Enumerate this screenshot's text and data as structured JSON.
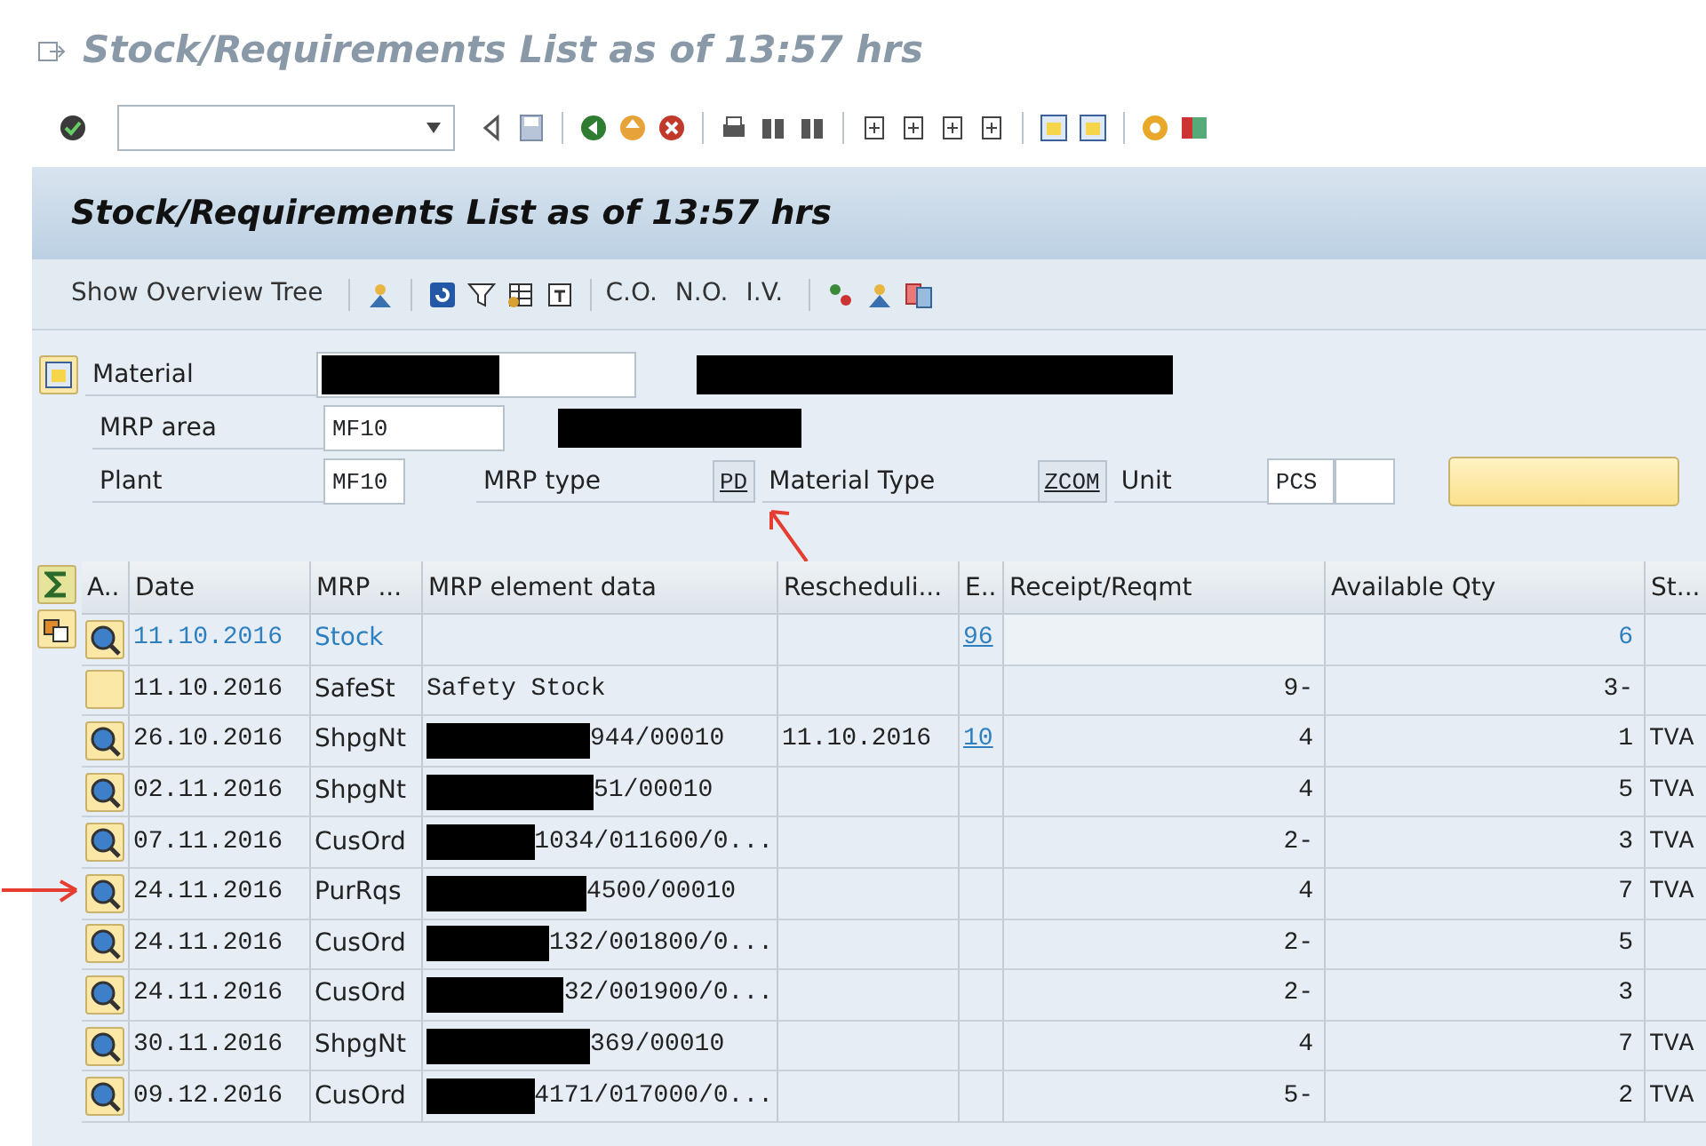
{
  "window": {
    "title": "Stock/Requirements List as of 13:57 hrs"
  },
  "screen_header": {
    "title": "Stock/Requirements List as of 13:57 hrs"
  },
  "app_toolbar": [
    {
      "kind": "text",
      "label": "Show Overview Tree"
    },
    {
      "kind": "text",
      "label": "C.O."
    },
    {
      "kind": "text",
      "label": "N.O."
    },
    {
      "kind": "text",
      "label": "I.V."
    }
  ],
  "form": {
    "material": {
      "label": "Material",
      "redacted": true
    },
    "mrp_area": {
      "label": "MRP area",
      "value": "MF10",
      "redacted": true
    },
    "plant": {
      "label": "Plant",
      "value": "MF10"
    },
    "mrp_type": {
      "label": "MRP type",
      "value": "PD"
    },
    "material_type": {
      "label": "Material Type",
      "value": "ZCOM"
    },
    "unit": {
      "label": "Unit",
      "value": "PCS"
    }
  },
  "table": {
    "columns": [
      "A..",
      "Date",
      "MRP ...",
      "MRP element data",
      "Rescheduli...",
      "E..",
      "Receipt/Reqmt",
      "Available Qty",
      "St..."
    ],
    "rows": [
      {
        "kind": "details",
        "link": true,
        "date": "11.10.2016",
        "mrp_element": "Stock",
        "exception": "96",
        "available": "6"
      },
      {
        "kind": "blank",
        "link": false,
        "date": "11.10.2016",
        "mrp_element": "SafeSt",
        "element_data": "Safety Stock",
        "receipt": "9-",
        "available": "3-"
      },
      {
        "kind": "details",
        "link": false,
        "date": "26.10.2016",
        "mrp_element": "ShpgNt",
        "redacted": true,
        "element_data": "944/00010",
        "rescheduling": "11.10.2016",
        "exception": "10",
        "receipt": "4",
        "available": "1",
        "storage": "TVA"
      },
      {
        "kind": "details",
        "link": false,
        "date": "02.11.2016",
        "mrp_element": "ShpgNt",
        "redacted": true,
        "element_data": "51/00010",
        "receipt": "4",
        "available": "5",
        "storage": "TVA"
      },
      {
        "kind": "details",
        "link": false,
        "date": "07.11.2016",
        "mrp_element": "CusOrd",
        "redacted": true,
        "element_data": "1034/011600/0...",
        "receipt": "2-",
        "available": "3",
        "storage": "TVA"
      },
      {
        "kind": "details",
        "link": false,
        "date": "24.11.2016",
        "mrp_element": "PurRqs",
        "redacted": true,
        "element_data": "4500/00010",
        "receipt": "4",
        "available": "7",
        "storage": "TVA"
      },
      {
        "kind": "details",
        "link": false,
        "date": "24.11.2016",
        "mrp_element": "CusOrd",
        "redacted": true,
        "element_data": "132/001800/0...",
        "receipt": "2-",
        "available": "5"
      },
      {
        "kind": "details",
        "link": false,
        "date": "24.11.2016",
        "mrp_element": "CusOrd",
        "redacted": true,
        "element_data": "32/001900/0...",
        "receipt": "2-",
        "available": "3"
      },
      {
        "kind": "details",
        "link": false,
        "date": "30.11.2016",
        "mrp_element": "ShpgNt",
        "redacted": true,
        "element_data": "369/00010",
        "receipt": "4",
        "available": "7",
        "storage": "TVA"
      },
      {
        "kind": "details",
        "link": false,
        "date": "09.12.2016",
        "mrp_element": "CusOrd",
        "redacted": true,
        "element_data": "4171/017000/0...",
        "receipt": "5-",
        "available": "2",
        "storage": "TVA"
      }
    ]
  }
}
